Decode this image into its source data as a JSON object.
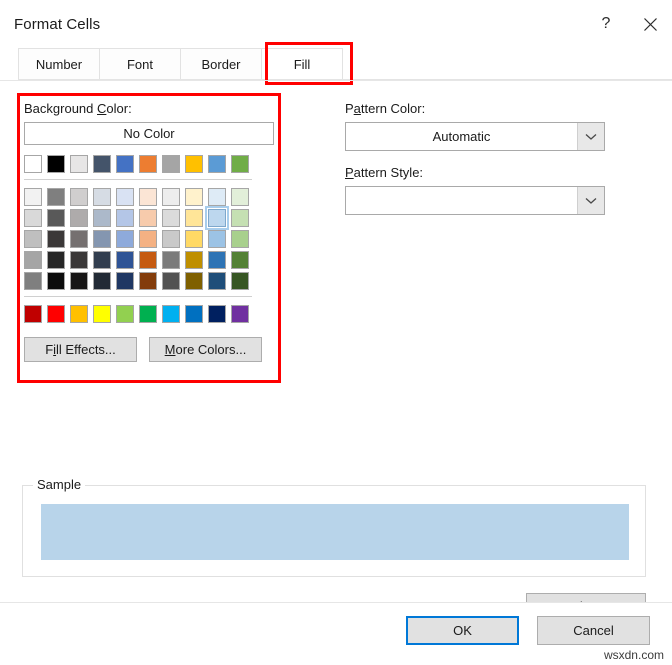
{
  "window": {
    "title": "Format Cells",
    "help_icon": "question-mark-icon",
    "close_icon": "close-icon"
  },
  "tabs": [
    {
      "label": "Number",
      "active": false
    },
    {
      "label": "Font",
      "active": false
    },
    {
      "label": "Border",
      "active": false
    },
    {
      "label": "Fill",
      "active": true
    }
  ],
  "fill_tab": {
    "background_color": {
      "label_pre": "Background ",
      "label_accel": "C",
      "label_post": "olor:",
      "no_color_label": "No Color",
      "standard_top_row": [
        "#FFFFFF",
        "#000000",
        "#E7E6E6",
        "#44546A",
        "#4472C4",
        "#ED7D31",
        "#A5A5A5",
        "#FFC000",
        "#5B9BD5",
        "#70AD47"
      ],
      "theme_rows": [
        [
          "#F2F2F2",
          "#7F7F7F",
          "#D0CECE",
          "#D6DCE4",
          "#D9E2F3",
          "#FBE5D5",
          "#EDEDED",
          "#FFF2CC",
          "#DEEBF6",
          "#E2EFD9"
        ],
        [
          "#D9D9D9",
          "#595959",
          "#AEABAB",
          "#ACB9CA",
          "#B4C6E7",
          "#F7CBAC",
          "#DBDBDB",
          "#FFE598",
          "#BDD7EE",
          "#C5E0B3"
        ],
        [
          "#BFBFBF",
          "#3B3838",
          "#757070",
          "#8496B0",
          "#8EAADB",
          "#F4B183",
          "#C9C9C9",
          "#FFD965",
          "#9CC3E5",
          "#A8D08D"
        ],
        [
          "#A5A5A5",
          "#262626",
          "#3A3838",
          "#323E4F",
          "#2F5496",
          "#C55A11",
          "#7B7B7B",
          "#BF8F00",
          "#2E74B5",
          "#538135"
        ],
        [
          "#7F7F7F",
          "#0C0C0C",
          "#171616",
          "#222A35",
          "#1F3763",
          "#833C0B",
          "#525252",
          "#7F6000",
          "#1F4E79",
          "#375623"
        ]
      ],
      "standard_bottom_row": [
        "#C00000",
        "#FF0000",
        "#FFC000",
        "#FFFF00",
        "#92D050",
        "#00B050",
        "#00B0F0",
        "#0070C0",
        "#002060",
        "#7030A0"
      ],
      "selected_swatch": {
        "row": 1,
        "col": 8,
        "color": "#BDD7EE"
      },
      "fill_effects_pre": "F",
      "fill_effects_accel": "i",
      "fill_effects_post": "ll Effects...",
      "more_colors_accel": "M",
      "more_colors_post": "ore Colors..."
    },
    "pattern_color": {
      "label_pre": "P",
      "label_accel": "a",
      "label_post": "ttern Color:",
      "value": "Automatic",
      "arrow_icon": "chevron-down-icon"
    },
    "pattern_style": {
      "label_accel": "P",
      "label_post": "attern Style:",
      "value": "",
      "arrow_icon": "chevron-down-icon"
    }
  },
  "sample": {
    "legend": "Sample",
    "fill_color": "#B8D4EA"
  },
  "clear_button": {
    "label_pre": "Clea",
    "label_accel": "r"
  },
  "footer": {
    "ok_label": "OK",
    "cancel_label": "Cancel"
  },
  "watermark": {
    "text": "wsxdn.com"
  },
  "annotations": {
    "highlight_color": "#FF0000",
    "boxes": [
      "fill-tab",
      "background-color-panel"
    ]
  }
}
